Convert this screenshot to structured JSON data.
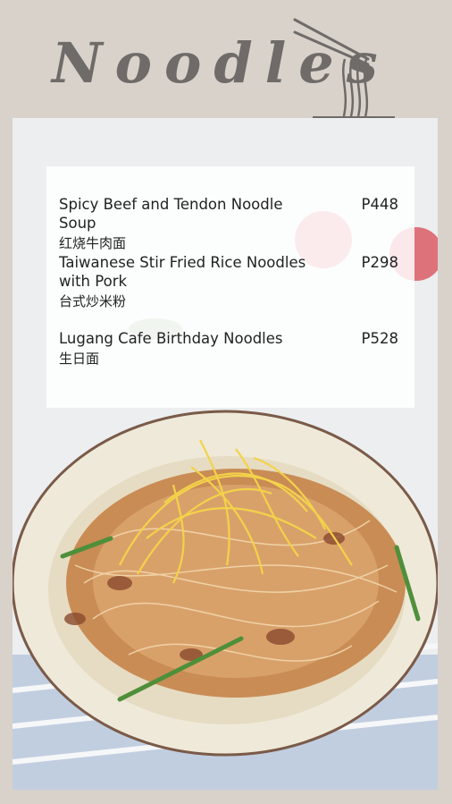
{
  "header": {
    "title": "Noodles"
  },
  "menu": {
    "items": [
      {
        "name": "Spicy Beef and Tendon Noodle Soup",
        "name_cn": "红烧牛肉面",
        "price": "P448"
      },
      {
        "name": "Taiwanese Stir Fried Rice Noodles with Pork",
        "name_cn": "台式炒米粉",
        "price": "P298"
      },
      {
        "name": "Lugang Cafe Birthday Noodles",
        "name_cn": "生日面",
        "price": "P528"
      }
    ]
  },
  "colors": {
    "background": "#d8d2cb",
    "title": "#6f6b69",
    "card": "#ffffff",
    "text": "#222222"
  },
  "icons": [
    "noodle-bowl-icon"
  ]
}
